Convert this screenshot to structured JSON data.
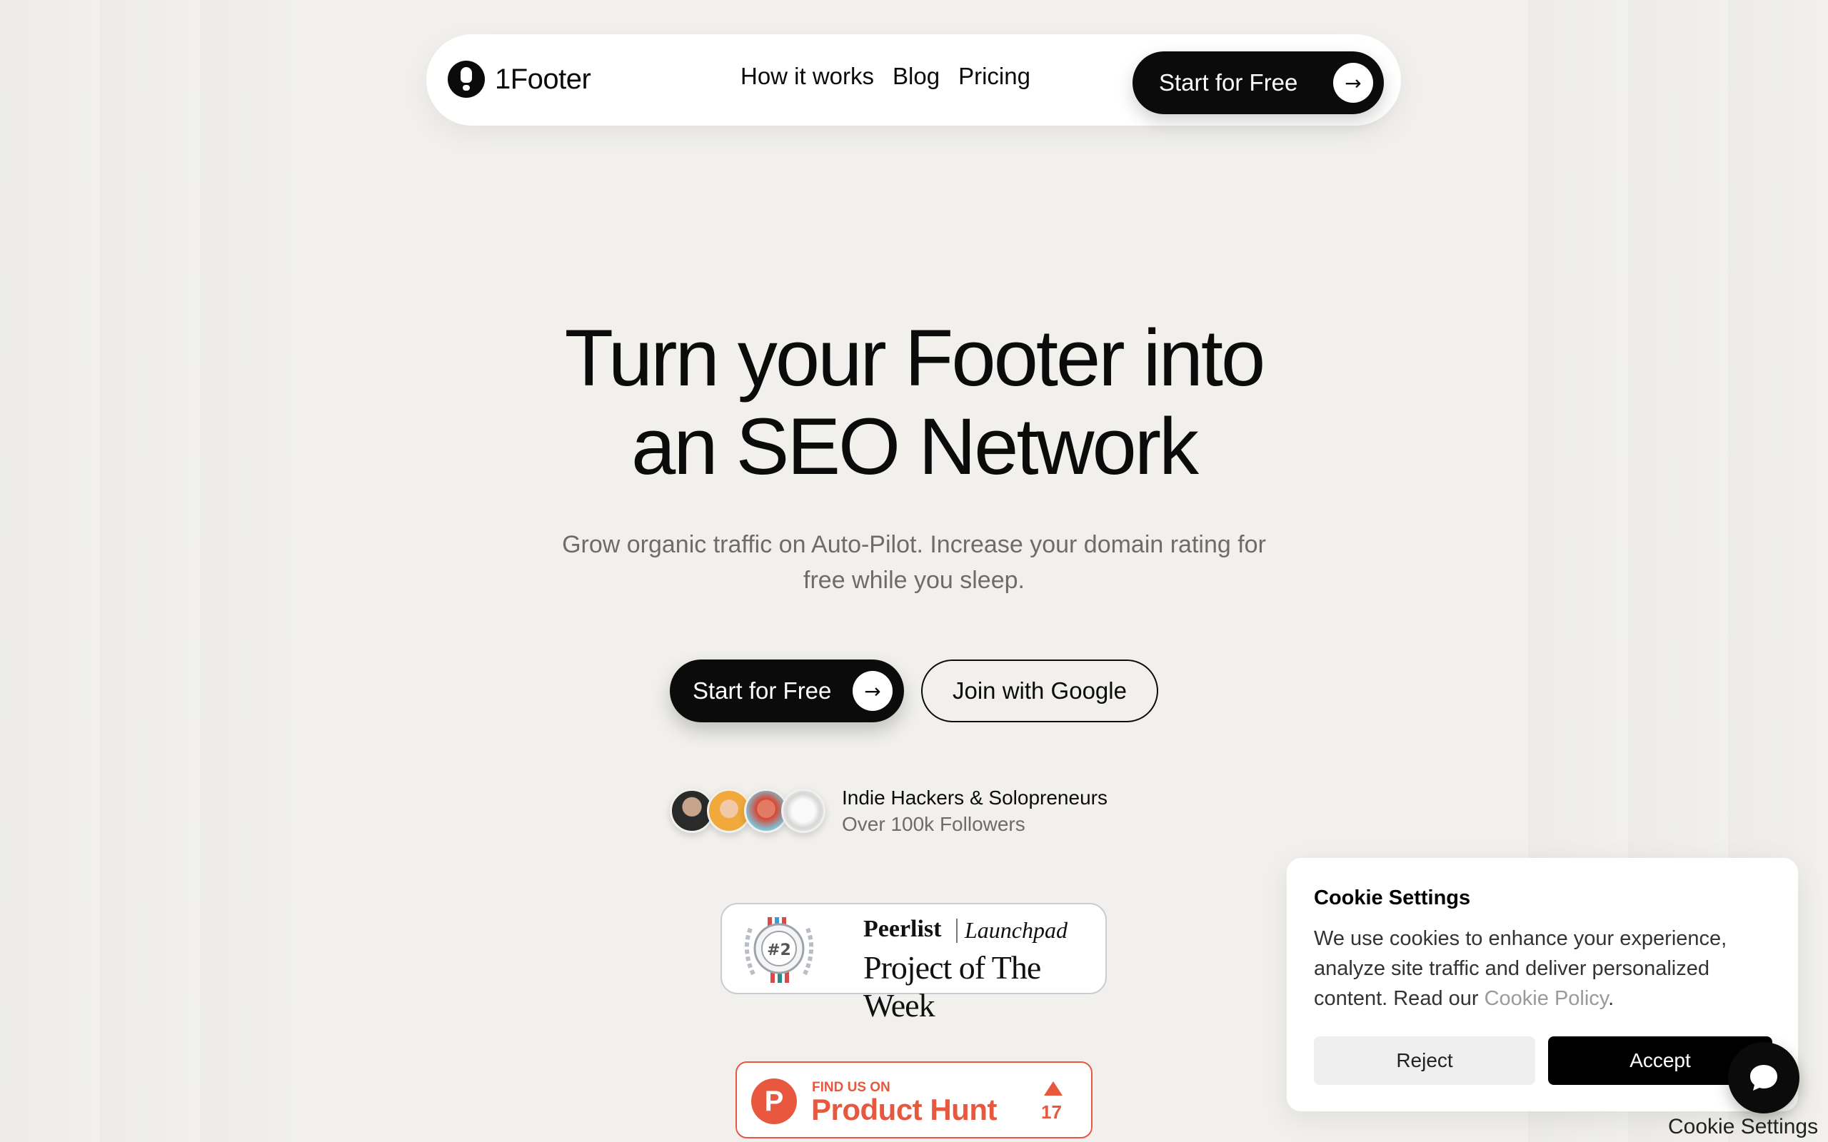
{
  "nav": {
    "logo_text": "1Footer",
    "links": [
      "How it works",
      "Blog",
      "Pricing"
    ],
    "cta_label": "Start for Free"
  },
  "hero": {
    "title_line1": "Turn your Footer into",
    "title_line2": "an SEO Network",
    "subtitle_line1": "Grow organic traffic on Auto-Pilot. Increase your domain rating for",
    "subtitle_line2": "free while you sleep.",
    "primary_cta": "Start for Free",
    "secondary_cta": "Join with Google"
  },
  "social_proof": {
    "line1": "Indie Hackers & Solopreneurs",
    "line2": "Over 100k Followers"
  },
  "peerlist_badge": {
    "brand": "Peerlist",
    "tag": "Launchpad",
    "rank": "#2",
    "subtitle": "Project of The Week"
  },
  "product_hunt_badge": {
    "find_text": "FIND US ON",
    "name": "Product Hunt",
    "upvotes": "17"
  },
  "cookie_banner": {
    "title": "Cookie Settings",
    "text_before_link": "We use cookies to enhance your experience, analyze site traffic and deliver personalized content. Read our ",
    "link_text": "Cookie Policy",
    "text_after_link": ".",
    "reject_label": "Reject",
    "accept_label": "Accept"
  },
  "footer_link": "Cookie Settings",
  "colors": {
    "background": "#f1f0ec",
    "primary": "#0b0b0b",
    "product_hunt": "#e8583f"
  },
  "icons": {
    "arrow": "arrow-right-icon",
    "chat": "chat-bubble-icon"
  }
}
